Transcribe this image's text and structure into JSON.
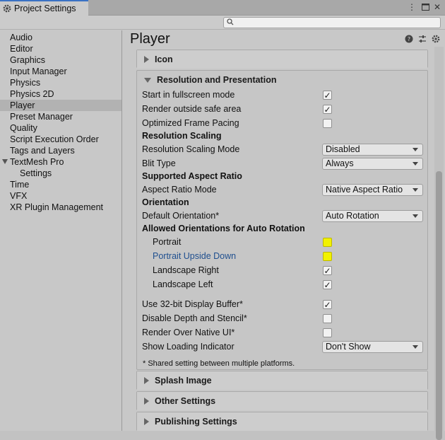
{
  "window": {
    "tab_title": "Project Settings",
    "tab_icon": "gear-icon"
  },
  "toolbar": {
    "search_placeholder": ""
  },
  "sidebar": {
    "items": [
      {
        "label": "Audio"
      },
      {
        "label": "Editor"
      },
      {
        "label": "Graphics"
      },
      {
        "label": "Input Manager"
      },
      {
        "label": "Physics"
      },
      {
        "label": "Physics 2D"
      },
      {
        "label": "Player",
        "selected": true
      },
      {
        "label": "Preset Manager"
      },
      {
        "label": "Quality"
      },
      {
        "label": "Script Execution Order"
      },
      {
        "label": "Tags and Layers"
      },
      {
        "label": "TextMesh Pro",
        "expanded": true
      },
      {
        "label": "Settings",
        "child": true
      },
      {
        "label": "Time"
      },
      {
        "label": "VFX"
      },
      {
        "label": "XR Plugin Management"
      }
    ]
  },
  "main": {
    "title": "Player",
    "sections": {
      "icon": "Icon",
      "resolution": "Resolution and Presentation",
      "splash": "Splash Image",
      "other": "Other Settings",
      "publishing": "Publishing Settings"
    },
    "rows": {
      "fullscreen": {
        "label": "Start in fullscreen mode",
        "checked": true
      },
      "safe_area": {
        "label": "Render outside safe area",
        "checked": true
      },
      "frame_pacing": {
        "label": "Optimized Frame Pacing",
        "checked": false
      },
      "res_scaling_header": "Resolution Scaling",
      "res_scaling_mode": {
        "label": "Resolution Scaling Mode",
        "value": "Disabled"
      },
      "blit_type": {
        "label": "Blit Type",
        "value": "Always"
      },
      "aspect_header": "Supported Aspect Ratio",
      "aspect_mode": {
        "label": "Aspect Ratio Mode",
        "value": "Native Aspect Ratio"
      },
      "orientation_header": "Orientation",
      "default_orientation": {
        "label": "Default Orientation*",
        "value": "Auto Rotation"
      },
      "allowed_header": "Allowed Orientations for Auto Rotation",
      "portrait": {
        "label": "Portrait",
        "checked": false,
        "highlight": true
      },
      "portrait_upside": {
        "label": "Portrait Upside Down",
        "checked": false,
        "highlight": true
      },
      "landscape_right": {
        "label": "Landscape Right",
        "checked": true
      },
      "landscape_left": {
        "label": "Landscape Left",
        "checked": true
      },
      "display_buffer": {
        "label": "Use 32-bit Display Buffer*",
        "checked": true
      },
      "depth_stencil": {
        "label": "Disable Depth and Stencil*",
        "checked": false
      },
      "native_ui": {
        "label": "Render Over Native UI*",
        "checked": false
      },
      "loading_indicator": {
        "label": "Show Loading Indicator",
        "value": "Don't Show"
      }
    },
    "footnote": "* Shared setting between multiple platforms."
  },
  "colors": {
    "accent": "#3a72c4",
    "highlight": "#f2f200",
    "link_blue": "#1f4f8f"
  }
}
